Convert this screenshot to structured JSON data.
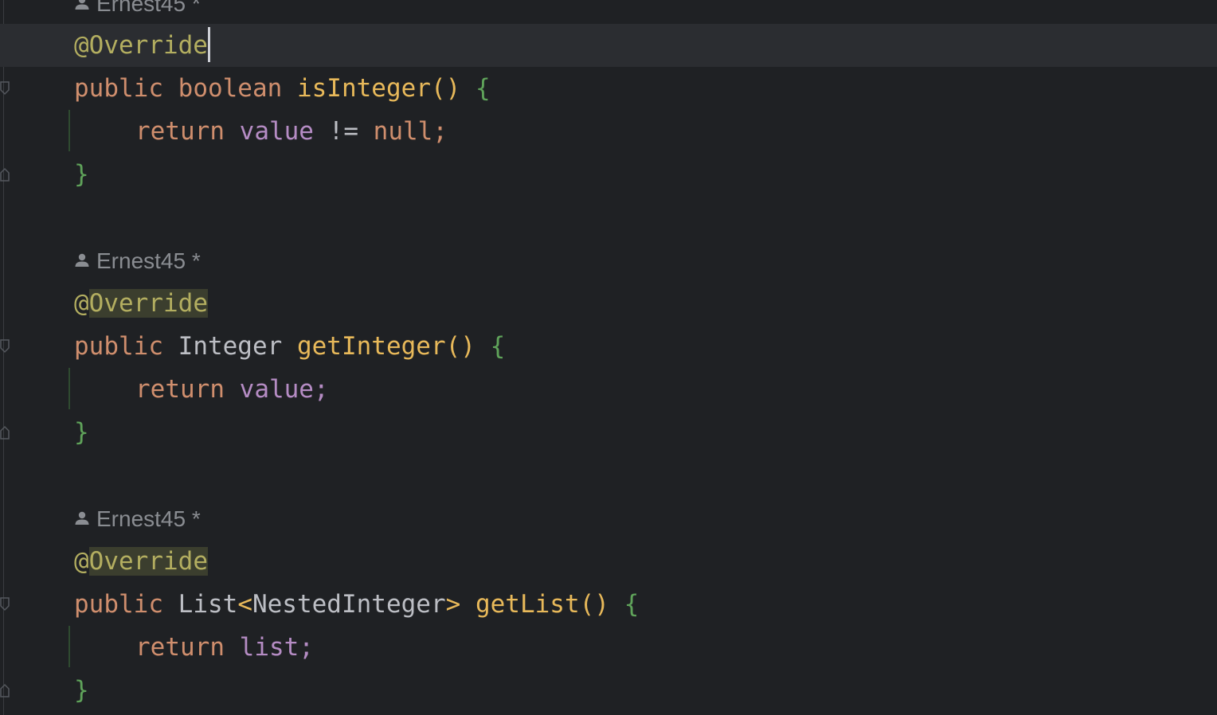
{
  "editor": {
    "author_top": "Ernest45 *",
    "blocks": [
      {
        "author": "Ernest45 *",
        "annotation": "@Override",
        "sig": {
          "mod": "public",
          "ret": "boolean",
          "name": "isInteger",
          "parens": "()",
          "open": "{"
        },
        "body": {
          "kw": "return",
          "field": "value",
          "op": "!=",
          "lit": "null;"
        },
        "close": "}"
      },
      {
        "author": "Ernest45 *",
        "annotation": "@Override",
        "sig": {
          "mod": "public",
          "ret": "Integer",
          "name": "getInteger",
          "parens": "()",
          "open": "{"
        },
        "body": {
          "kw": "return",
          "field": "value;"
        },
        "close": "}"
      },
      {
        "author": "Ernest45 *",
        "annotation": "@Override",
        "sig": {
          "mod": "public",
          "ret_list": "List",
          "lt": "<",
          "ret_generic": "NestedInteger",
          "gt": ">",
          "name": "getList",
          "parens": "()",
          "open": "{"
        },
        "body": {
          "kw": "return",
          "field": "list;"
        },
        "close": "}"
      }
    ]
  }
}
